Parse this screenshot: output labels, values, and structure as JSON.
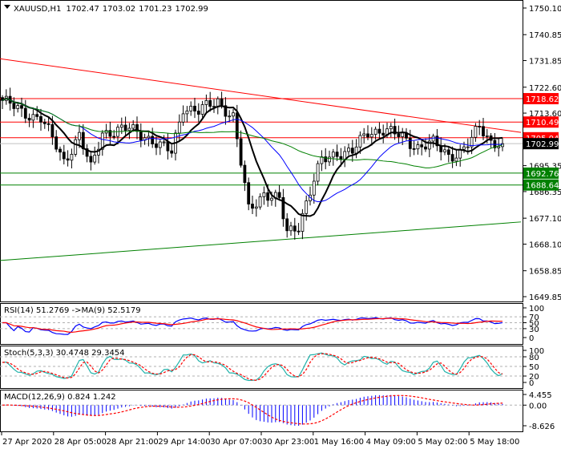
{
  "chart_data": {
    "type": "candlestick",
    "symbol_header": {
      "symbol": "XAUUSD,H1",
      "open": "1702.47",
      "high": "1703.02",
      "low": "1701.23",
      "close": "1702.99"
    },
    "price_axis": {
      "ylim": [
        1649.85,
        1750.1
      ],
      "ticks": [
        "1750.10",
        "1740.85",
        "1731.85",
        "1722.60",
        "1713.60",
        "1695.35",
        "1686.35",
        "1677.10",
        "1668.10",
        "1658.85",
        "1649.85"
      ]
    },
    "price_path_keypoints": [
      [
        0,
        1718
      ],
      [
        5,
        1714
      ],
      [
        10,
        1712
      ],
      [
        16,
        1697
      ],
      [
        20,
        1706
      ],
      [
        23,
        1694
      ],
      [
        26,
        1707
      ],
      [
        33,
        1708
      ],
      [
        37,
        1706
      ],
      [
        41,
        1702
      ],
      [
        44,
        1700
      ],
      [
        47,
        1716
      ],
      [
        51,
        1714
      ],
      [
        56,
        1718
      ],
      [
        60,
        1712
      ],
      [
        62,
        1696
      ],
      [
        64,
        1680
      ],
      [
        68,
        1686
      ],
      [
        72,
        1683
      ],
      [
        74,
        1672
      ],
      [
        77,
        1675
      ],
      [
        81,
        1690
      ],
      [
        83,
        1697
      ],
      [
        87,
        1700
      ],
      [
        91,
        1700
      ],
      [
        95,
        1707
      ],
      [
        99,
        1708
      ],
      [
        104,
        1705
      ],
      [
        108,
        1702
      ],
      [
        112,
        1703
      ],
      [
        116,
        1699
      ],
      [
        119,
        1700
      ],
      [
        122,
        1704
      ],
      [
        124,
        1709
      ],
      [
        127,
        1704
      ],
      [
        130,
        1702.99
      ]
    ],
    "bar_count": 131,
    "levels": [
      {
        "label": "1718.62",
        "value": 1718.62,
        "color": "#ff0000"
      },
      {
        "label": "1710.49",
        "value": 1710.49,
        "color": "#ff0000"
      },
      {
        "label": "1705.04",
        "value": 1705.04,
        "color": "#ff0000"
      },
      {
        "label": "1702.99",
        "value": 1702.99,
        "color": "#000000",
        "current": true
      },
      {
        "label": "1692.76",
        "value": 1692.76,
        "color": "#008000"
      },
      {
        "label": "1688.64",
        "value": 1688.64,
        "color": "#008000"
      }
    ],
    "trendlines": [
      {
        "name": "resistance",
        "color": "#ff0000",
        "from": [
          0,
          1732.5
        ],
        "to": [
          135,
          1706.9
        ]
      },
      {
        "name": "support",
        "color": "#008000",
        "from": [
          0,
          1662.4
        ],
        "to": [
          135,
          1675.8
        ]
      }
    ],
    "moving_averages": [
      {
        "name": "MA fast",
        "period": 9,
        "color": "#000000"
      },
      {
        "name": "MA mid",
        "period": 21,
        "color": "#0000ff"
      },
      {
        "name": "MA slow",
        "period": 50,
        "color": "#008000"
      }
    ],
    "x_labels": [
      "27 Apr 2020",
      "28 Apr 05:00",
      "28 Apr 21:00",
      "29 Apr 14:00",
      "30 Apr 07:00",
      "30 Apr 23:00",
      "1 May 16:00",
      "4 May 09:00",
      "5 May 02:00",
      "5 May 18:00"
    ],
    "rsi": {
      "title": "RSI(14) 51.2769  ->MA(9) 52.5179",
      "ticks": [
        "100",
        "70",
        "50",
        "30",
        "0"
      ],
      "levels": [
        70,
        50,
        30
      ],
      "color": "#0000ff",
      "ma_color": "#ff0000"
    },
    "stoch": {
      "title": "Stoch(5,3,3) 30.4748 29.3454",
      "ticks": [
        "100",
        "80",
        "50",
        "20",
        "0"
      ],
      "levels": [
        80,
        50,
        20
      ],
      "k_color": "#20b2aa",
      "d_color": "#ff0000"
    },
    "macd": {
      "title": "MACD(12,26,9) 0.824 1.242",
      "ticks": [
        "4.455",
        "0.00",
        "-8.626"
      ],
      "ylim": [
        -8.626,
        4.455
      ],
      "hist_color": "#0000ff",
      "signal_color": "#ff0000"
    }
  }
}
